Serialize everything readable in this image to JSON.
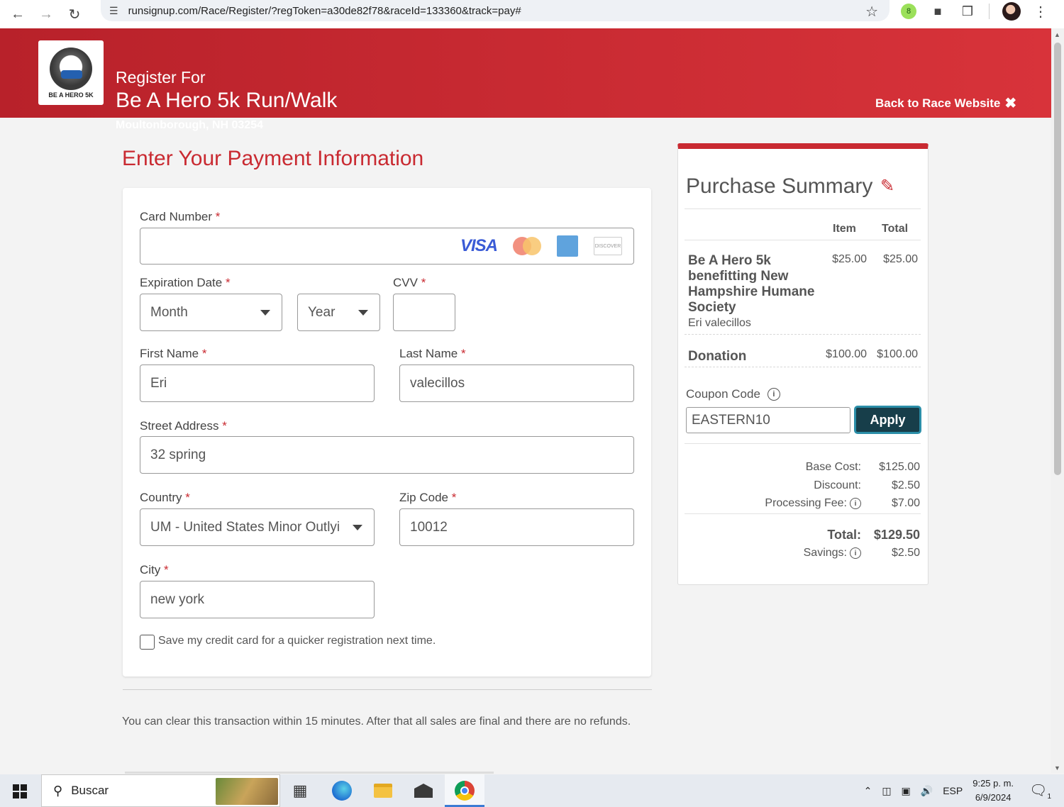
{
  "browser": {
    "url": "runsignup.com/Race/Register/?regToken=a30de82f78&raceId=133360&track=pay#",
    "ext_badge": "8"
  },
  "header": {
    "register_for": "Register For",
    "race_title": "Be A Hero 5k Run/Walk",
    "location": "Moultonborough, NH 03254",
    "back_link": "Back to Race Website",
    "logo_text": "BE A HERO 5K"
  },
  "form": {
    "heading": "Enter Your Payment Information",
    "card_number": {
      "label": "Card Number",
      "value": ""
    },
    "card_brands": {
      "visa": "VISA",
      "discover": "DISCOVER"
    },
    "expiration": {
      "label": "Expiration Date",
      "month": "Month",
      "year": "Year"
    },
    "cvv": {
      "label": "CVV",
      "value": ""
    },
    "first_name": {
      "label": "First Name",
      "value": "Eri"
    },
    "last_name": {
      "label": "Last Name",
      "value": "valecillos"
    },
    "street": {
      "label": "Street Address",
      "value": "32 spring"
    },
    "country": {
      "label": "Country",
      "value": "UM - United States Minor Outlyi"
    },
    "zip": {
      "label": "Zip Code",
      "value": "10012"
    },
    "city": {
      "label": "City",
      "value": "new york"
    },
    "save_card": "Save my credit card for a quicker registration next time.",
    "required_mark": "*"
  },
  "refund_note": "You can clear this transaction within 15 minutes. After that all sales are final and there are no refunds.",
  "summary": {
    "title": "Purchase Summary",
    "col_item": "Item",
    "col_total": "Total",
    "item_name": "Be A Hero 5k benefitting New Hampshire Humane Society",
    "item_participant": "Eri valecillos",
    "item_price": "$25.00",
    "item_total": "$25.00",
    "donation_label": "Donation",
    "donation_price": "$100.00",
    "donation_total": "$100.00",
    "coupon_label": "Coupon Code",
    "coupon_value": "EASTERN10",
    "apply": "Apply",
    "base_cost_label": "Base Cost:",
    "base_cost": "$125.00",
    "discount_label": "Discount:",
    "discount": "$2.50",
    "fee_label": "Processing Fee:",
    "fee": "$7.00",
    "total_label": "Total:",
    "total": "$129.50",
    "savings_label": "Savings:",
    "savings": "$2.50"
  },
  "taskbar": {
    "search": "Buscar",
    "lang": "ESP",
    "time": "9:25 p. m.",
    "date": "6/9/2024",
    "notif_count": "1"
  },
  "colors": {
    "brand_red": "#c92a31",
    "apply_bg": "#173e4a"
  }
}
